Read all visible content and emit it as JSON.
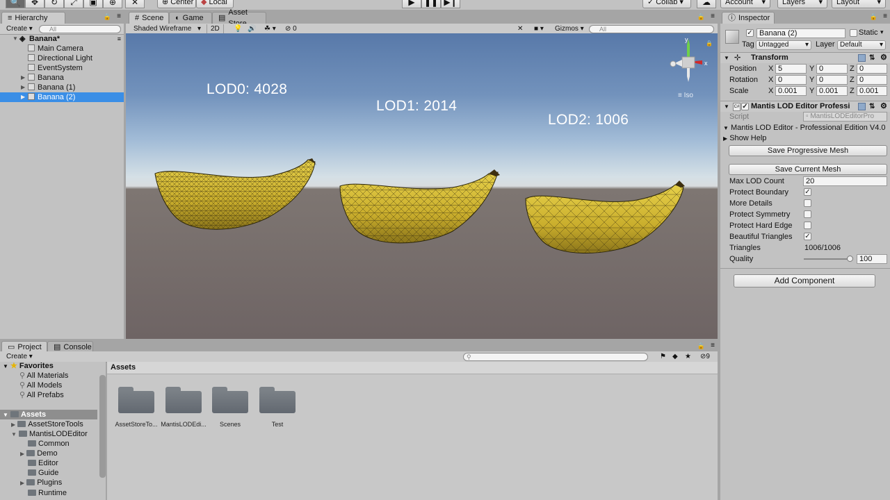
{
  "toolbar": {
    "pivot": "Center",
    "space": "Local",
    "collab": "Collab",
    "account": "Account",
    "layers": "Layers",
    "layout": "Layout"
  },
  "hierarchy": {
    "tab": "Hierarchy",
    "create": "Create",
    "search_placeholder": "All",
    "scene": "Banana*",
    "items": [
      "Main Camera",
      "Directional Light",
      "EventSystem",
      "Banana",
      "Banana (1)",
      "Banana (2)"
    ]
  },
  "scene": {
    "tabs": [
      "Scene",
      "Game",
      "Asset Store"
    ],
    "shading": "Shaded Wireframe",
    "mode_2d": "2D",
    "hidden_count": "0",
    "gizmos": "Gizmos",
    "search_placeholder": "All",
    "projection": "Iso",
    "axis_y": "y",
    "axis_x": "x",
    "lod_labels": [
      "LOD0: 4028",
      "LOD1: 2014",
      "LOD2: 1006"
    ]
  },
  "inspector": {
    "tab": "Inspector",
    "object_name": "Banana (2)",
    "static_label": "Static",
    "tag_label": "Tag",
    "tag_value": "Untagged",
    "layer_label": "Layer",
    "layer_value": "Default",
    "transform": {
      "title": "Transform",
      "rows": [
        {
          "label": "Position",
          "x": "5",
          "y": "0",
          "z": "0"
        },
        {
          "label": "Rotation",
          "x": "0",
          "y": "0",
          "z": "0"
        },
        {
          "label": "Scale",
          "x": "0.001",
          "y": "0.001",
          "z": "0.001"
        }
      ],
      "axis_x": "X",
      "axis_y": "Y",
      "axis_z": "Z"
    },
    "mantis": {
      "title": "Mantis LOD Editor Professi",
      "script_label": "Script",
      "script_value": "MantisLODEditorPro",
      "edition": "Mantis LOD Editor - Professional Edition V4.0",
      "show_help": "Show Help",
      "save_progressive": "Save Progressive Mesh",
      "save_current": "Save Current Mesh",
      "max_lod_label": "Max LOD Count",
      "max_lod_value": "20",
      "protect_boundary": "Protect Boundary",
      "more_details": "More Details",
      "protect_symmetry": "Protect Symmetry",
      "protect_hard_edge": "Protect Hard Edge",
      "beautiful_triangles": "Beautiful Triangles",
      "triangles_label": "Triangles",
      "triangles_value": "1006/1006",
      "quality_label": "Quality",
      "quality_value": "100",
      "quality_fraction": 1.0
    },
    "add_component": "Add Component"
  },
  "project": {
    "tabs": [
      "Project",
      "Console"
    ],
    "create": "Create",
    "hidden_count": "9",
    "favorites": "Favorites",
    "favorite_items": [
      "All Materials",
      "All Models",
      "All Prefabs"
    ],
    "assets_root": "Assets",
    "tree": [
      {
        "label": "AssetStoreTools",
        "level": 1
      },
      {
        "label": "MantisLODEditor",
        "level": 1
      },
      {
        "label": "Common",
        "level": 2
      },
      {
        "label": "Demo",
        "level": 2
      },
      {
        "label": "Editor",
        "level": 2
      },
      {
        "label": "Guide",
        "level": 2
      },
      {
        "label": "Plugins",
        "level": 2
      },
      {
        "label": "Runtime",
        "level": 2
      }
    ],
    "breadcrumb": "Assets",
    "folders": [
      "AssetStoreTo...",
      "MantisLODEdi...",
      "Scenes",
      "Test"
    ]
  }
}
